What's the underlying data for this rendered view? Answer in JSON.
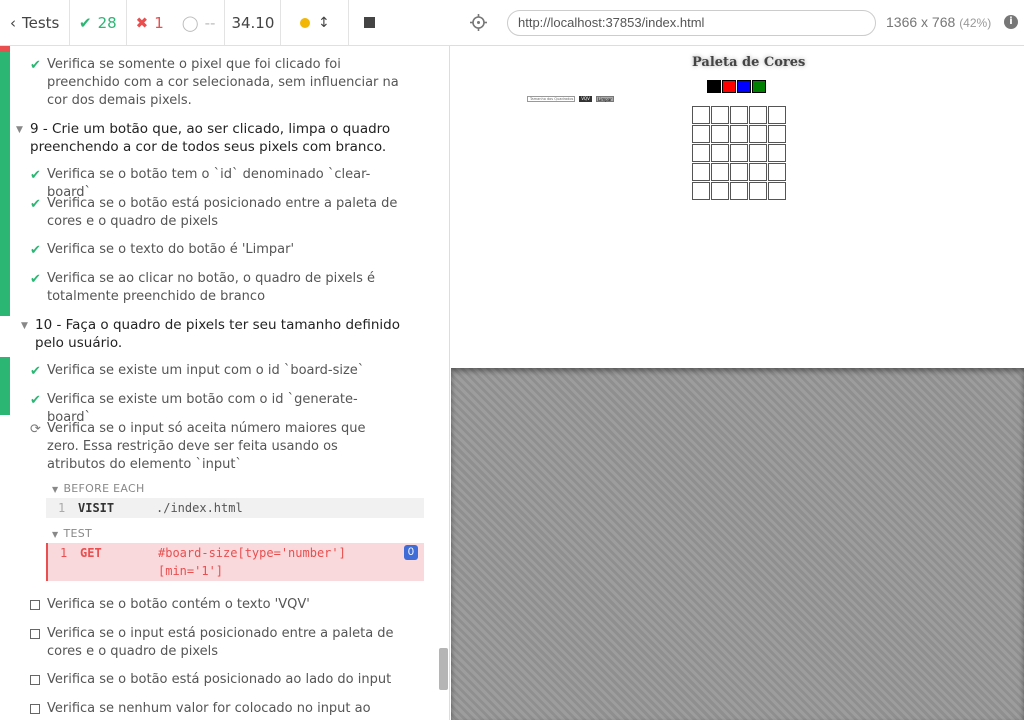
{
  "topbar": {
    "tests_label": "Tests",
    "passed": "28",
    "failed": "1",
    "pending": "--",
    "duration": "34.10"
  },
  "spec": {
    "items": [
      {
        "kind": "test",
        "status": "passed",
        "text": "Verifica se somente o pixel que foi clicado foi preenchido com a cor selecionada, sem influenciar na cor dos demais pixels."
      },
      {
        "kind": "suite",
        "text": "9 - Crie um botão que, ao ser clicado, limpa o quadro preenchendo a cor de todos seus pixels com branco."
      },
      {
        "kind": "test",
        "status": "passed",
        "text": "Verifica se o botão tem o `id` denominado `clear-board`"
      },
      {
        "kind": "test",
        "status": "passed",
        "text": "Verifica se o botão está posicionado entre a paleta de cores e o quadro de pixels"
      },
      {
        "kind": "test",
        "status": "passed",
        "text": "Verifica se o texto do botão é 'Limpar'"
      },
      {
        "kind": "test",
        "status": "passed",
        "text": "Verifica se ao clicar no botão, o quadro de pixels é totalmente preenchido de branco"
      },
      {
        "kind": "suite",
        "text": "10 - Faça o quadro de pixels ter seu tamanho definido pelo usuário."
      },
      {
        "kind": "test",
        "status": "passed",
        "text": "Verifica se existe um input com o id `board-size`"
      },
      {
        "kind": "test",
        "status": "passed",
        "text": "Verifica se existe um botão com o id `generate-board`"
      },
      {
        "kind": "test",
        "status": "running",
        "text": "Verifica se o input só aceita número maiores que zero. Essa restrição deve ser feita usando os atributos do elemento `input`"
      },
      {
        "kind": "test",
        "status": "pending",
        "text": "Verifica se o botão contém o texto 'VQV'"
      },
      {
        "kind": "test",
        "status": "pending",
        "text": "Verifica se o input está posicionado entre a paleta de cores e o quadro de pixels"
      },
      {
        "kind": "test",
        "status": "pending",
        "text": "Verifica se o botão está posicionado ao lado do input"
      },
      {
        "kind": "test",
        "status": "pending",
        "text": "Verifica se nenhum valor for colocado no input ao clicar no"
      }
    ],
    "hooks": {
      "before_each_label": "BEFORE EACH",
      "test_label": "TEST",
      "visit": {
        "num": "1",
        "name": "VISIT",
        "arg": "./index.html"
      },
      "get": {
        "num": "1",
        "name": "GET",
        "arg": "#board-size[type='number'][min='1']",
        "badge": "0"
      }
    }
  },
  "browser": {
    "url": "http://localhost:37853/index.html",
    "viewport": "1366 x 768",
    "scale": "(42%)",
    "info": "i"
  },
  "aut": {
    "title": "Paleta de Cores",
    "palette": [
      "#000000",
      "#ff0000",
      "#0000ff",
      "#008000"
    ],
    "board_size_placeholder": "Tamanho dos Quadrados",
    "vqv_label": "VQV",
    "clear_label": "Limpar",
    "board_rows": 5,
    "board_cols": 5
  }
}
